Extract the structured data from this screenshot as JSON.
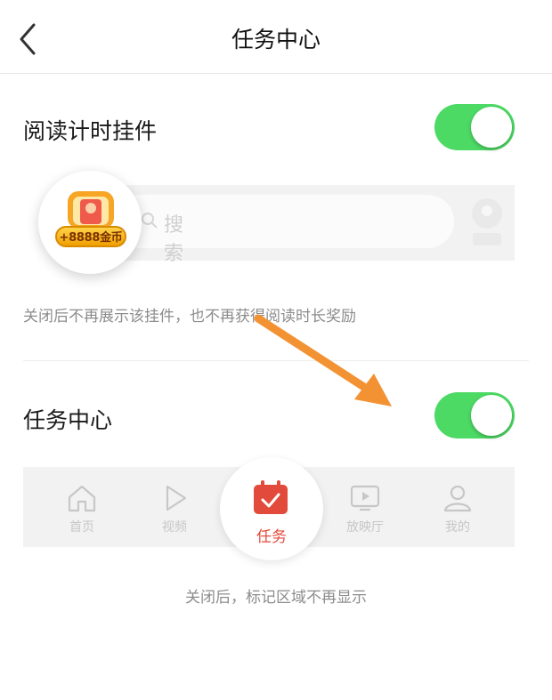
{
  "header": {
    "title": "任务中心",
    "back_icon": "chevron-left-icon"
  },
  "reading_widget": {
    "label": "阅读计时挂件",
    "enabled": true,
    "preview": {
      "search_placeholder": "搜索",
      "coin_badge": "+8888金币"
    },
    "hint": "关闭后不再展示该挂件，也不再获得阅读时长奖励"
  },
  "task_center": {
    "label": "任务中心",
    "enabled": true,
    "preview_tabs": [
      {
        "label": "首页",
        "icon": "home-icon"
      },
      {
        "label": "视频",
        "icon": "play-icon"
      },
      {
        "label": "任务",
        "icon": "calendar-check-icon",
        "highlighted": true
      },
      {
        "label": "放映厅",
        "icon": "tv-icon"
      },
      {
        "label": "我的",
        "icon": "user-icon"
      }
    ],
    "hint": "关闭后，标记区域不再显示"
  },
  "colors": {
    "toggle_on": "#4cd964",
    "highlight": "#e24a3b",
    "annotation_arrow": "#f39232"
  }
}
